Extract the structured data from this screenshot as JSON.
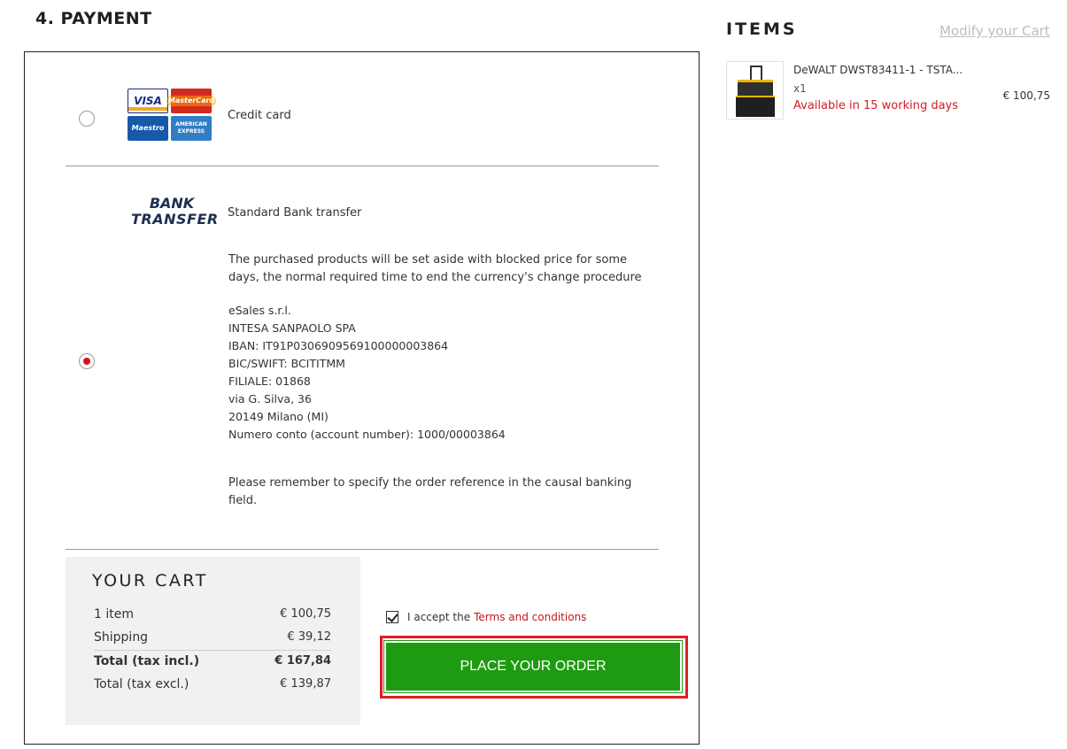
{
  "section_title": "4. PAYMENT",
  "payment_options": [
    {
      "label": "Credit card",
      "selected": false,
      "logos": [
        "VISA",
        "MasterCard",
        "Maestro",
        "AMERICAN EXPRESS"
      ]
    },
    {
      "label": "Standard Bank transfer",
      "selected": true,
      "logo_line1": "BANK",
      "logo_line2": "TRANSFER",
      "description": [
        "The purchased products will be set aside with blocked price for some",
        "days, the normal required time to end the currency's change procedure"
      ],
      "bank_details": [
        "eSales s.r.l.",
        "INTESA SANPAOLO SPA",
        "IBAN: IT91P0306909569100000003864",
        "BIC/SWIFT: BCITITMM",
        "FILIALE: 01868",
        "via G. Silva, 36",
        "20149 Milano (MI)",
        "Numero conto (account number): 1000/00003864"
      ],
      "reminder": [
        "Please remember to specify the order reference in the causal banking",
        "field."
      ]
    }
  ],
  "cart": {
    "title": "YOUR CART",
    "rows": [
      {
        "label": "1 item",
        "value": "€ 100,75"
      },
      {
        "label": "Shipping",
        "value": "€ 39,12"
      },
      {
        "label": "Total (tax incl.)",
        "value": "€ 167,84"
      },
      {
        "label": "Total (tax excl.)",
        "value": "€ 139,87"
      }
    ]
  },
  "terms": {
    "checked": true,
    "prefix": "I accept the",
    "link": "Terms and conditions"
  },
  "order_button": "PLACE YOUR ORDER",
  "items": {
    "title": "ITEMS",
    "modify_link": "Modify your Cart",
    "list": [
      {
        "name": "DeWALT DWST83411-1 - TSTA...",
        "qty": "x1",
        "availability": "Available in 15 working days",
        "price": "€ 100,75"
      }
    ]
  },
  "colors": {
    "accent_red": "#d0202a",
    "order_green": "#1e9b12"
  }
}
